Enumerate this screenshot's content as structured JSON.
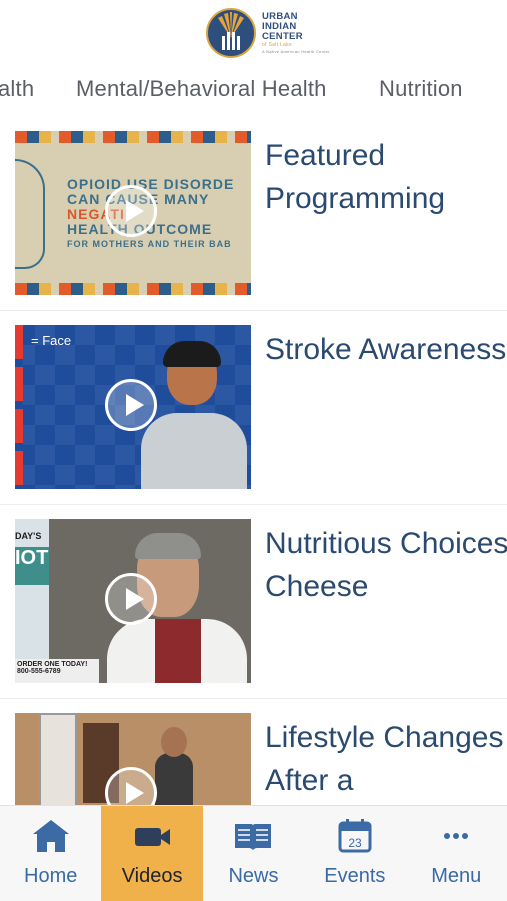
{
  "header": {
    "logo_line1": "URBAN",
    "logo_line2": "INDIAN",
    "logo_line3": "CENTER",
    "logo_line4": "of Salt Lake",
    "logo_line5": "A Native American Health Center"
  },
  "tabs": [
    {
      "label": "alth"
    },
    {
      "label": "Mental/Behavioral Health"
    },
    {
      "label": "Nutrition"
    }
  ],
  "videos": [
    {
      "title": "Featured Programming",
      "thumb_lines": [
        "OPIOID USE DISORDE",
        "CAN CAUSE MANY",
        "NEGATI",
        "HEALTH OUTCOME",
        "FOR MOTHERS AND THEIR BAB"
      ]
    },
    {
      "title": "Stroke Awareness",
      "thumb_label": "= Face"
    },
    {
      "title": "Nutritious Choices - Cheese",
      "thumb_ad_top": "DAY'S",
      "thumb_ad_big": "IOT",
      "thumb_banner_1": "ORDER ONE TODAY!",
      "thumb_banner_2": "800-555-6789"
    },
    {
      "title": "Lifestyle Changes After a"
    }
  ],
  "bottom_nav": [
    {
      "label": "Home",
      "icon": "home-icon",
      "active": false
    },
    {
      "label": "Videos",
      "icon": "video-camera-icon",
      "active": true
    },
    {
      "label": "News",
      "icon": "newspaper-icon",
      "active": false
    },
    {
      "label": "Events",
      "icon": "calendar-icon",
      "active": false,
      "badge": "23"
    },
    {
      "label": "Menu",
      "icon": "more-dots-icon",
      "active": false
    }
  ],
  "colors": {
    "title_blue": "#2b4a70",
    "nav_blue": "#3b6aa5",
    "active_tab_bg": "#f0b04a"
  }
}
